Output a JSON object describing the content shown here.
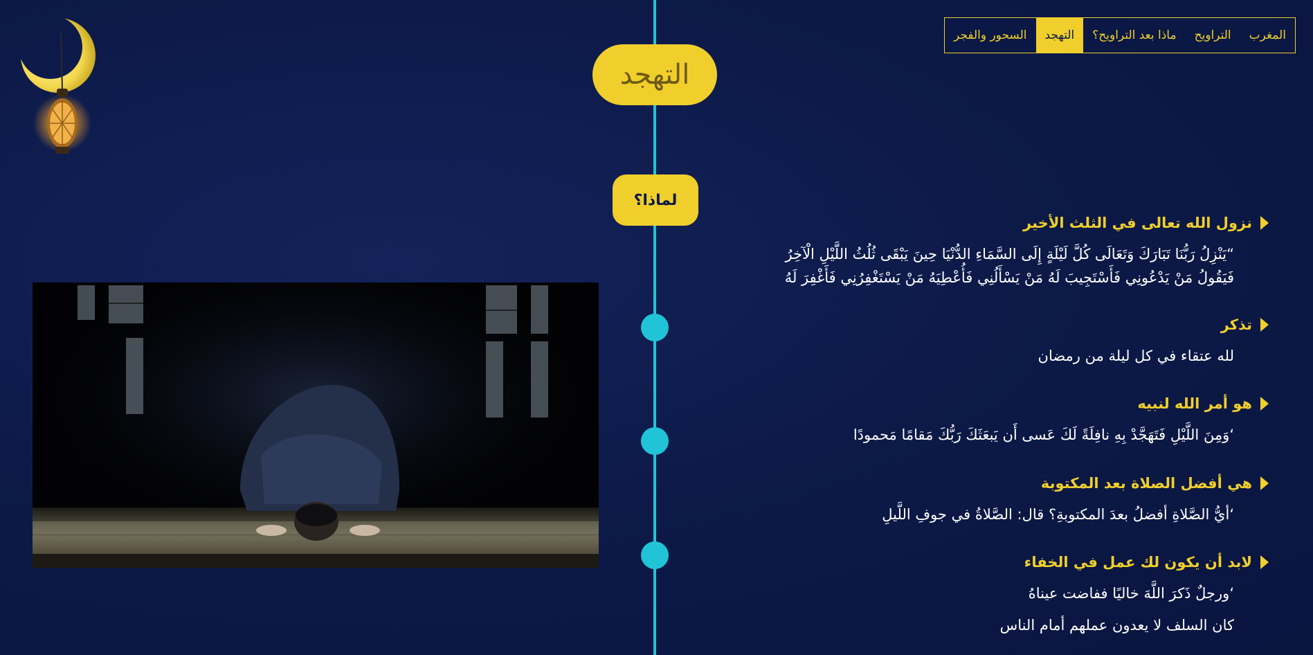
{
  "nav": {
    "items": [
      {
        "label": "المغرب",
        "active": false
      },
      {
        "label": "التراويح",
        "active": false
      },
      {
        "label": "ماذا بعد التراويح؟",
        "active": false
      },
      {
        "label": "التهجد",
        "active": true
      },
      {
        "label": "السحور والفجر",
        "active": false
      }
    ]
  },
  "page_title": "التهجد",
  "why_label": "لماذا؟",
  "sections": [
    {
      "heading": "نزول الله تعالى في الثلث الأخير",
      "lines": [
        "“يَنْزِلُ رَبُّنَا تَبَارَكَ وَتَعَالَى كُلَّ لَيْلَةٍ إِلَى السَّمَاءِ الدُّنْيَا حِينَ يَبْقَى ثُلُثُ اللَّيْلِ الْآخِرُ",
        "فَيَقُولُ مَنْ يَدْعُونِي فَأَسْتَجِيبَ لَهُ مَنْ يَسْأَلُنِي فَأُعْطِيَهُ مَنْ يَسْتَغْفِرُنِي فَأَغْفِرَ لَهُ"
      ]
    },
    {
      "heading": "تذكر",
      "lines": [
        "لله عتقاء في كل ليلة من رمضان"
      ]
    },
    {
      "heading": "هو أمر الله لنبيه",
      "lines": [
        "‘وَمِنَ اللَّيْلِ فَتَهَجَّدْ بِهِ نافِلَةً لَكَ عَسى أَن يَبعَثَكَ رَبُّكَ مَقامًا مَحمودًا"
      ]
    },
    {
      "heading": "هي أفضل الصلاة بعد المكتوبة",
      "lines": [
        "‘أيُّ الصَّلاةِ أفضلُ بعدَ المكتوبةِ؟ قال: الصَّلاةُ في جوفِ اللَّيلِ"
      ]
    },
    {
      "heading": "لابد أن يكون لك عمل في الخفاء",
      "lines": [
        "‘ورجلٌ ذَكرَ اللَّهَ خاليًا ففاضت عيناهُ",
        "كان السلف لا يعدون عملهم أمام الناس"
      ]
    }
  ],
  "decorations": {
    "lantern": "crescent-lantern-icon",
    "photo": "man-praying-sujood-photo"
  },
  "colors": {
    "background": "#0c1946",
    "accent": "#f0cf2c",
    "timeline": "#20c4d6",
    "text": "#ffffff"
  }
}
